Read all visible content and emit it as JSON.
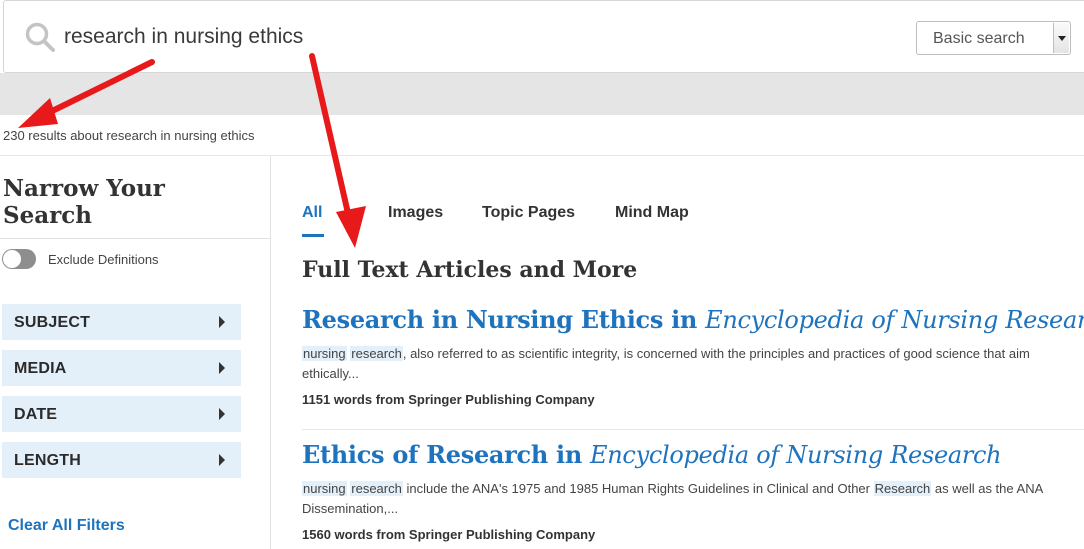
{
  "search": {
    "query": "research in nursing ethics",
    "mode": "Basic search"
  },
  "results_summary": "230 results about research in nursing ethics",
  "sidebar": {
    "title": "Narrow Your Search",
    "toggle_label": "Exclude Definitions",
    "filters": [
      "SUBJECT",
      "MEDIA",
      "DATE",
      "LENGTH"
    ],
    "clear_label": "Clear All Filters"
  },
  "tabs": [
    "All",
    "Images",
    "Topic Pages",
    "Mind Map"
  ],
  "active_tab": "All",
  "section_title": "Full Text Articles and More",
  "results": [
    {
      "title_main": "Research in Nursing Ethics in ",
      "title_source": "Encyclopedia of Nursing Research",
      "snippet_hl1": "nursing",
      "snippet_hl2": "research",
      "snippet_rest": ", also referred to as scientific integrity, is concerned with the principles and practices of good science that aim",
      "snippet_line2": "ethically...",
      "meta": "1151 words from Springer Publishing Company"
    },
    {
      "title_main": "Ethics of Research in ",
      "title_source": "Encyclopedia of Nursing Research",
      "snippet_hl1": "nursing",
      "snippet_hl2": "research",
      "snippet_rest": " include the ANA's 1975 and 1985 Human Rights Guidelines in Clinical and Other ",
      "snippet_hl3": "Research",
      "snippet_rest2": " as well as the ANA",
      "snippet_line2": "Dissemination,...",
      "meta": "1560 words from Springer Publishing Company"
    }
  ],
  "colors": {
    "link": "#1e73be",
    "highlight": "#e3eff9",
    "annotation_arrow": "#e8191b"
  }
}
